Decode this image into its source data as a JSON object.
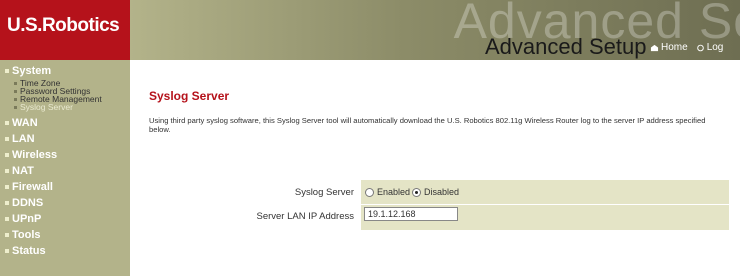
{
  "header": {
    "brand": "U.S.Robotics",
    "watermark": "Advanced Se",
    "setup_title": "Advanced Setup",
    "nav": [
      {
        "label": "Home",
        "icon": "home-icon"
      },
      {
        "label": "Log",
        "icon": "logout-icon"
      }
    ]
  },
  "sidebar": {
    "system": "System",
    "system_items": [
      "Time Zone",
      "Password Settings",
      "Remote Management",
      "Syslog Server"
    ],
    "sections": [
      "WAN",
      "LAN",
      "Wireless",
      "NAT",
      "Firewall",
      "DDNS",
      "UPnP",
      "Tools",
      "Status"
    ]
  },
  "main": {
    "title": "Syslog Server",
    "description": "Using third party syslog software, this Syslog Server tool will automatically download the U.S. Robotics 802.11g Wireless Router log to the server IP address specified below.",
    "syslog_label": "Syslog Server",
    "enabled_label": "Enabled",
    "disabled_label": "Disabled",
    "selected": "Disabled",
    "ip_label": "Server LAN IP Address",
    "ip_value": "19.1.12.168"
  },
  "colors": {
    "brand_red": "#b5121b",
    "sidebar": "#b3b38a",
    "form_bg": "#e4e4c6"
  }
}
